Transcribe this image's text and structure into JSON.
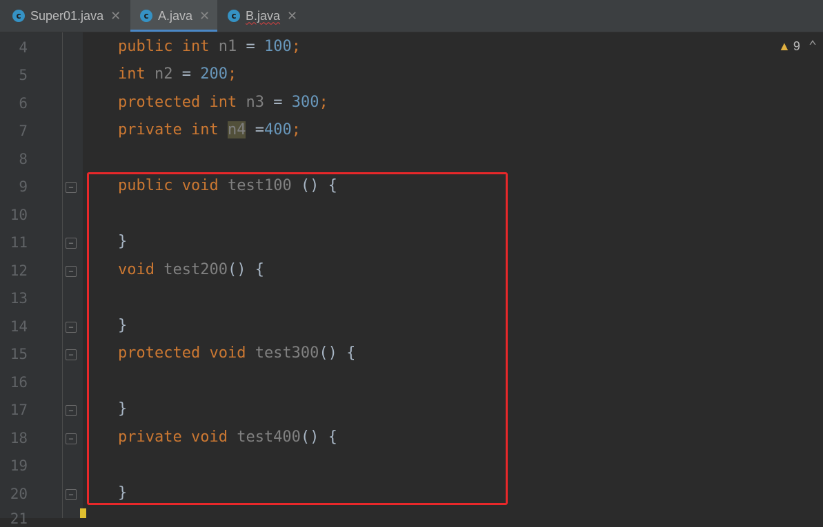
{
  "tabs": [
    {
      "label": "Super01.java",
      "icon": "class-c-icon"
    },
    {
      "label": "A.java",
      "icon": "class-c-icon"
    },
    {
      "label": "B.java",
      "icon": "class-c-icon"
    }
  ],
  "warning": {
    "count": "9"
  },
  "line_numbers": [
    "4",
    "5",
    "6",
    "7",
    "8",
    "9",
    "10",
    "11",
    "12",
    "13",
    "14",
    "15",
    "16",
    "17",
    "18",
    "19",
    "20",
    "21"
  ],
  "code": {
    "l4": {
      "mod": "public",
      "type": "int",
      "name": "n1",
      "eq": " = ",
      "val": "100",
      "semi": ";"
    },
    "l5": {
      "type": "int",
      "name": "n2",
      "eq": " = ",
      "val": "200",
      "semi": ";"
    },
    "l6": {
      "mod": "protected",
      "type": "int",
      "name": "n3",
      "eq": " = ",
      "val": "300",
      "semi": ";"
    },
    "l7": {
      "mod": "private",
      "type": "int",
      "name": "n4",
      "eq": " =",
      "val": "400",
      "semi": ";"
    },
    "l9": {
      "mod": "public",
      "ret": "void",
      "name": "test100",
      "rest": " () {"
    },
    "l11": {
      "text": "}"
    },
    "l12": {
      "ret": "void",
      "name": "test200",
      "rest": "() {"
    },
    "l14": {
      "text": "}"
    },
    "l15": {
      "mod": "protected",
      "ret": "void",
      "name": "test300",
      "rest": "() {"
    },
    "l17": {
      "text": "}"
    },
    "l18": {
      "mod": "private",
      "ret": "void",
      "name": "test400",
      "rest": "() {"
    },
    "l20": {
      "text": "}"
    }
  },
  "colors": {
    "keyword": "#cc7832",
    "number": "#6897bb",
    "highlight_box": "#e8282a"
  }
}
